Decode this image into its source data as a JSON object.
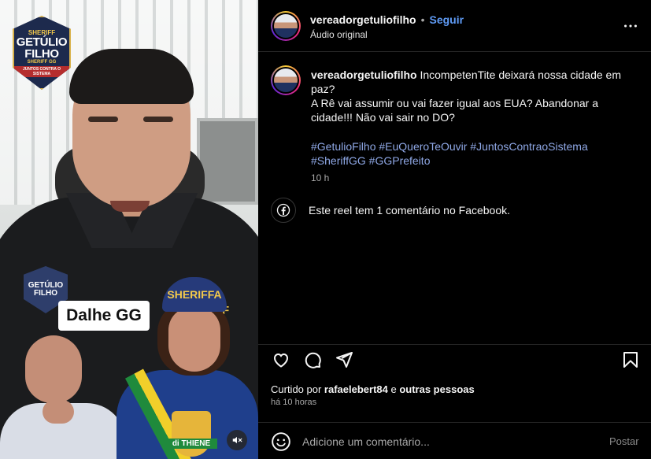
{
  "post": {
    "username": "vereadorgetuliofilho",
    "separator": "•",
    "follow_label": "Seguir",
    "audio_label": "Áudio original",
    "more_icon": "more-options-icon"
  },
  "media": {
    "badge_top": {
      "line1": "SHERIFF",
      "line2": "GETÚLIO",
      "line3": "FILHO",
      "line4": "SHERIFF GG",
      "line5": "JUNTOS CONTRA O SISTEMA"
    },
    "badge_shirt": {
      "line1": "GETÚLIO",
      "line2": "FILHO"
    },
    "overlay_label": "Dalhe GG",
    "shoulder_text": "F",
    "cap_text": "SHERIFFA",
    "crest_label": "di THIENE",
    "mute_icon": "muted-speaker-icon"
  },
  "caption": {
    "username": "vereadorgetuliofilho",
    "text_line1": " IncompetenTite deixará nossa cidade em paz?",
    "text_line2": "A Rê vai assumir ou vai fazer igual aos EUA? Abandonar a cidade!!! Não vai sair no DO?",
    "hashtags_line1": "#GetulioFilho #EuQueroTeOuvir #JuntosContraoSistema",
    "hashtags_line2": "#SheriffGG #GGPrefeito",
    "time": "10 h"
  },
  "facebook_note": {
    "icon": "facebook-icon",
    "text": "Este reel tem 1 comentário no Facebook."
  },
  "actions": {
    "like_icon": "heart-icon",
    "comment_icon": "comment-icon",
    "share_icon": "share-icon",
    "save_icon": "bookmark-icon"
  },
  "likes": {
    "prefix": "Curtido por ",
    "user": "rafaelebert84",
    "middle": " e ",
    "others": "outras pessoas"
  },
  "timestamp": "há 10 horas",
  "comment_box": {
    "emoji_icon": "emoji-icon",
    "placeholder": "Adicione um comentário...",
    "post_label": "Postar"
  },
  "colors": {
    "background": "#000000",
    "accent_link": "#5f9bf5",
    "hashtag": "#8fa8e6",
    "muted_text": "#a8a8a8",
    "divider": "#262626"
  }
}
